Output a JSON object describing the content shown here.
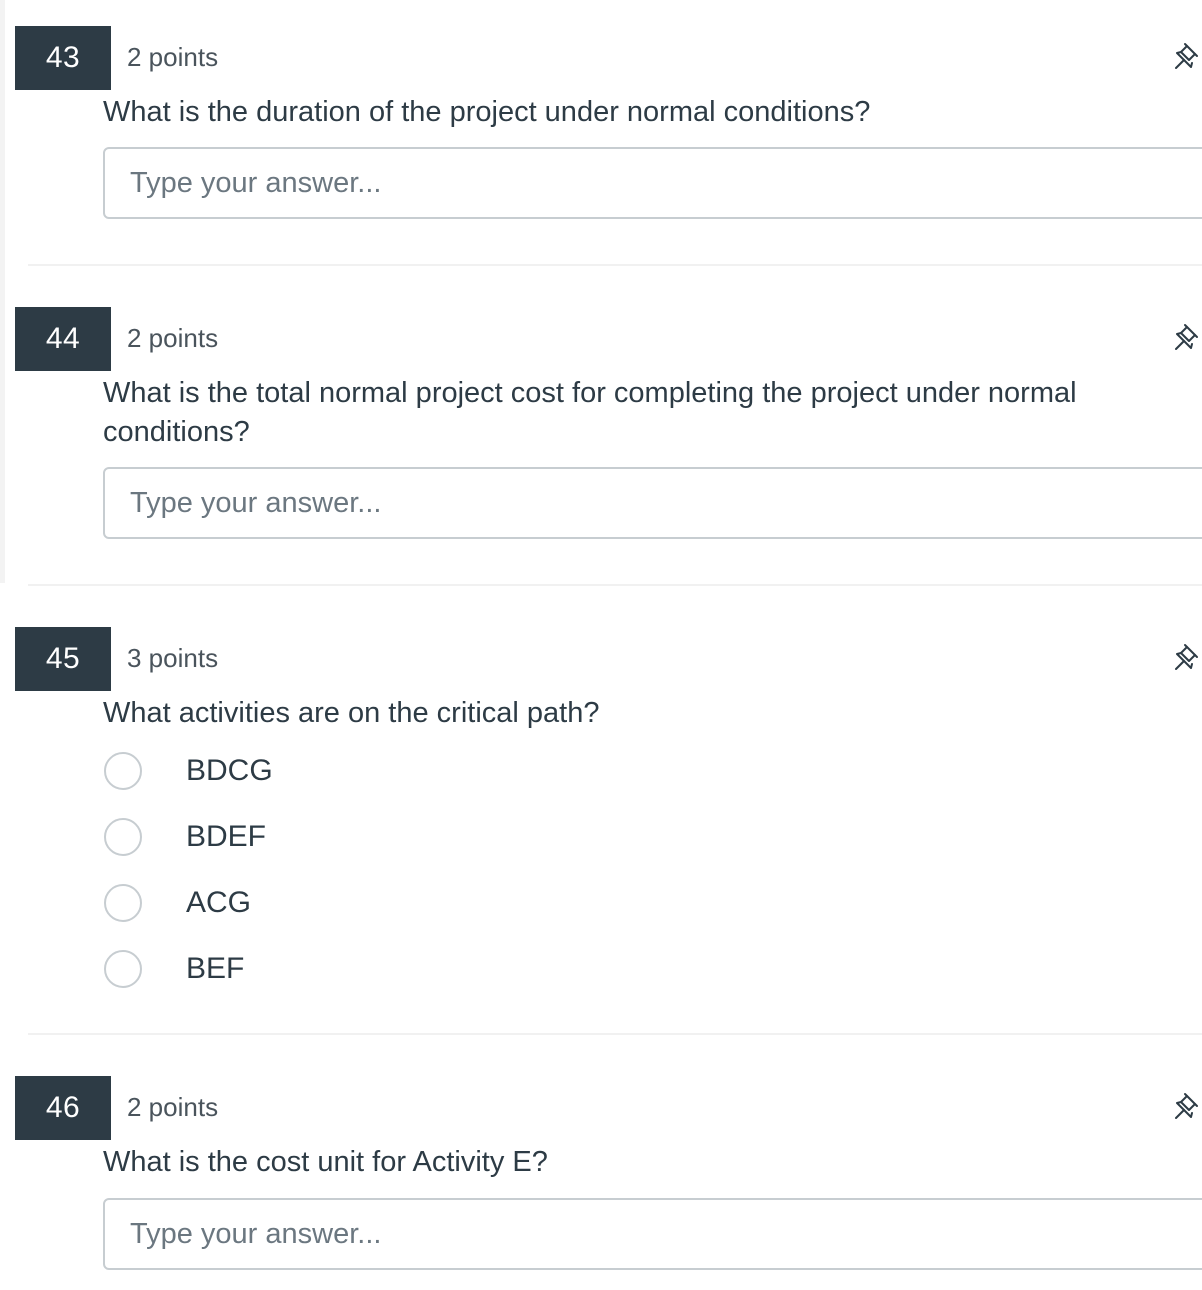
{
  "questions": [
    {
      "number": "43",
      "points": "2 points",
      "text": "What is the duration of the project under normal conditions?",
      "type": "text",
      "placeholder": "Type your answer..."
    },
    {
      "number": "44",
      "points": "2 points",
      "text": "What is the total normal project cost for completing the project under normal conditions?",
      "type": "text",
      "placeholder": "Type your answer..."
    },
    {
      "number": "45",
      "points": "3 points",
      "text": "What activities are on the critical path?",
      "type": "choice",
      "options": [
        "BDCG",
        "BDEF",
        "ACG",
        "BEF"
      ]
    },
    {
      "number": "46",
      "points": "2 points",
      "text": "What is the cost unit for Activity E?",
      "type": "text",
      "placeholder": "Type your answer..."
    }
  ],
  "icons": {
    "pin": "pin-icon"
  },
  "colors": {
    "number_badge_bg": "#2d3b45",
    "number_badge_text": "#ffffff",
    "text": "#2d3b45",
    "border": "#c7cdd1"
  }
}
